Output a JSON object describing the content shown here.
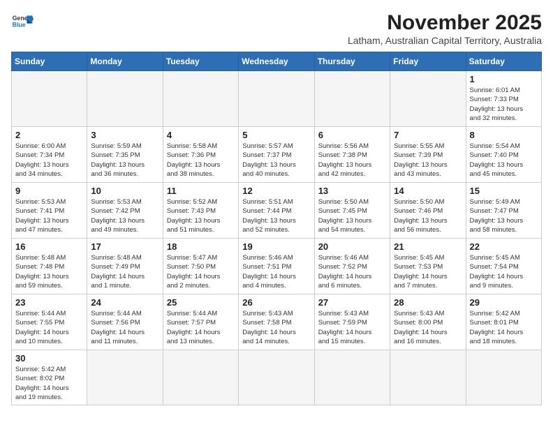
{
  "header": {
    "logo_line1": "General",
    "logo_line2": "Blue",
    "month": "November 2025",
    "subtitle": "Latham, Australian Capital Territory, Australia"
  },
  "days_of_week": [
    "Sunday",
    "Monday",
    "Tuesday",
    "Wednesday",
    "Thursday",
    "Friday",
    "Saturday"
  ],
  "weeks": [
    [
      {
        "day": "",
        "info": ""
      },
      {
        "day": "",
        "info": ""
      },
      {
        "day": "",
        "info": ""
      },
      {
        "day": "",
        "info": ""
      },
      {
        "day": "",
        "info": ""
      },
      {
        "day": "",
        "info": ""
      },
      {
        "day": "1",
        "info": "Sunrise: 6:01 AM\nSunset: 7:33 PM\nDaylight: 13 hours\nand 32 minutes."
      }
    ],
    [
      {
        "day": "2",
        "info": "Sunrise: 6:00 AM\nSunset: 7:34 PM\nDaylight: 13 hours\nand 34 minutes."
      },
      {
        "day": "3",
        "info": "Sunrise: 5:59 AM\nSunset: 7:35 PM\nDaylight: 13 hours\nand 36 minutes."
      },
      {
        "day": "4",
        "info": "Sunrise: 5:58 AM\nSunset: 7:36 PM\nDaylight: 13 hours\nand 38 minutes."
      },
      {
        "day": "5",
        "info": "Sunrise: 5:57 AM\nSunset: 7:37 PM\nDaylight: 13 hours\nand 40 minutes."
      },
      {
        "day": "6",
        "info": "Sunrise: 5:56 AM\nSunset: 7:38 PM\nDaylight: 13 hours\nand 42 minutes."
      },
      {
        "day": "7",
        "info": "Sunrise: 5:55 AM\nSunset: 7:39 PM\nDaylight: 13 hours\nand 43 minutes."
      },
      {
        "day": "8",
        "info": "Sunrise: 5:54 AM\nSunset: 7:40 PM\nDaylight: 13 hours\nand 45 minutes."
      }
    ],
    [
      {
        "day": "9",
        "info": "Sunrise: 5:53 AM\nSunset: 7:41 PM\nDaylight: 13 hours\nand 47 minutes."
      },
      {
        "day": "10",
        "info": "Sunrise: 5:53 AM\nSunset: 7:42 PM\nDaylight: 13 hours\nand 49 minutes."
      },
      {
        "day": "11",
        "info": "Sunrise: 5:52 AM\nSunset: 7:43 PM\nDaylight: 13 hours\nand 51 minutes."
      },
      {
        "day": "12",
        "info": "Sunrise: 5:51 AM\nSunset: 7:44 PM\nDaylight: 13 hours\nand 52 minutes."
      },
      {
        "day": "13",
        "info": "Sunrise: 5:50 AM\nSunset: 7:45 PM\nDaylight: 13 hours\nand 54 minutes."
      },
      {
        "day": "14",
        "info": "Sunrise: 5:50 AM\nSunset: 7:46 PM\nDaylight: 13 hours\nand 56 minutes."
      },
      {
        "day": "15",
        "info": "Sunrise: 5:49 AM\nSunset: 7:47 PM\nDaylight: 13 hours\nand 58 minutes."
      }
    ],
    [
      {
        "day": "16",
        "info": "Sunrise: 5:48 AM\nSunset: 7:48 PM\nDaylight: 13 hours\nand 59 minutes."
      },
      {
        "day": "17",
        "info": "Sunrise: 5:48 AM\nSunset: 7:49 PM\nDaylight: 14 hours\nand 1 minute."
      },
      {
        "day": "18",
        "info": "Sunrise: 5:47 AM\nSunset: 7:50 PM\nDaylight: 14 hours\nand 2 minutes."
      },
      {
        "day": "19",
        "info": "Sunrise: 5:46 AM\nSunset: 7:51 PM\nDaylight: 14 hours\nand 4 minutes."
      },
      {
        "day": "20",
        "info": "Sunrise: 5:46 AM\nSunset: 7:52 PM\nDaylight: 14 hours\nand 6 minutes."
      },
      {
        "day": "21",
        "info": "Sunrise: 5:45 AM\nSunset: 7:53 PM\nDaylight: 14 hours\nand 7 minutes."
      },
      {
        "day": "22",
        "info": "Sunrise: 5:45 AM\nSunset: 7:54 PM\nDaylight: 14 hours\nand 9 minutes."
      }
    ],
    [
      {
        "day": "23",
        "info": "Sunrise: 5:44 AM\nSunset: 7:55 PM\nDaylight: 14 hours\nand 10 minutes."
      },
      {
        "day": "24",
        "info": "Sunrise: 5:44 AM\nSunset: 7:56 PM\nDaylight: 14 hours\nand 11 minutes."
      },
      {
        "day": "25",
        "info": "Sunrise: 5:44 AM\nSunset: 7:57 PM\nDaylight: 14 hours\nand 13 minutes."
      },
      {
        "day": "26",
        "info": "Sunrise: 5:43 AM\nSunset: 7:58 PM\nDaylight: 14 hours\nand 14 minutes."
      },
      {
        "day": "27",
        "info": "Sunrise: 5:43 AM\nSunset: 7:59 PM\nDaylight: 14 hours\nand 15 minutes."
      },
      {
        "day": "28",
        "info": "Sunrise: 5:43 AM\nSunset: 8:00 PM\nDaylight: 14 hours\nand 16 minutes."
      },
      {
        "day": "29",
        "info": "Sunrise: 5:42 AM\nSunset: 8:01 PM\nDaylight: 14 hours\nand 18 minutes."
      }
    ],
    [
      {
        "day": "30",
        "info": "Sunrise: 5:42 AM\nSunset: 8:02 PM\nDaylight: 14 hours\nand 19 minutes."
      },
      {
        "day": "",
        "info": ""
      },
      {
        "day": "",
        "info": ""
      },
      {
        "day": "",
        "info": ""
      },
      {
        "day": "",
        "info": ""
      },
      {
        "day": "",
        "info": ""
      },
      {
        "day": "",
        "info": ""
      }
    ]
  ]
}
